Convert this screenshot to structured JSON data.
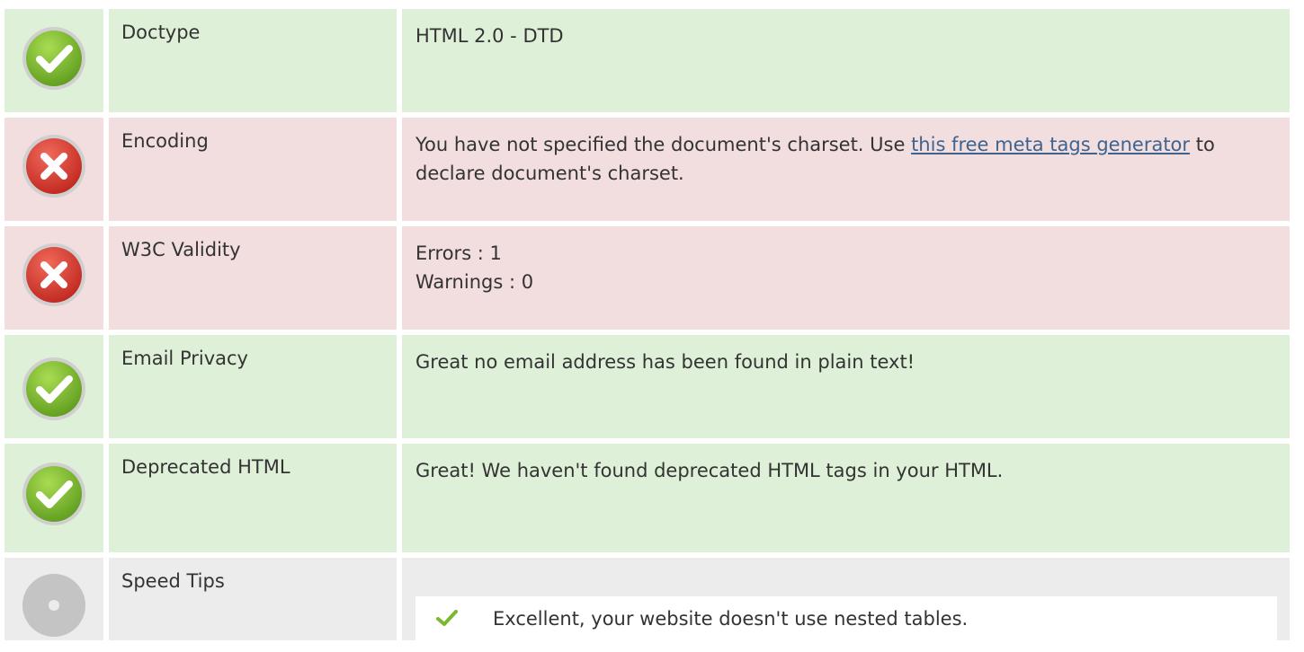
{
  "rows": [
    {
      "status": "pass",
      "icon": "check-circle-icon",
      "label": "Doctype",
      "value": "HTML 2.0 - DTD"
    },
    {
      "status": "fail",
      "icon": "error-circle-icon",
      "label": "Encoding",
      "value_before": "You have not specified the document's charset. Use ",
      "link_text": "this free meta tags generator",
      "value_after": " to declare document's charset."
    },
    {
      "status": "fail",
      "icon": "error-circle-icon",
      "label": "W3C Validity",
      "line1": "Errors : 1",
      "line2": "Warnings : 0"
    },
    {
      "status": "pass",
      "icon": "check-circle-icon",
      "label": "Email Privacy",
      "value": "Great no email address has been found in plain text!"
    },
    {
      "status": "pass",
      "icon": "check-circle-icon",
      "label": "Deprecated HTML",
      "value": "Great! We haven't found deprecated HTML tags in your HTML."
    },
    {
      "status": "info",
      "icon": "info-circle-icon",
      "label": "Speed Tips",
      "tips": [
        {
          "icon": "checkmark-icon",
          "text": "Excellent, your website doesn't use nested tables."
        }
      ]
    }
  ],
  "colors": {
    "pass_bg": "#dff0d8",
    "fail_bg": "#f2dede",
    "info_bg": "#ececec",
    "link": "#3d6490",
    "check_green": "#7cb82f",
    "error_red": "#d9342b"
  }
}
